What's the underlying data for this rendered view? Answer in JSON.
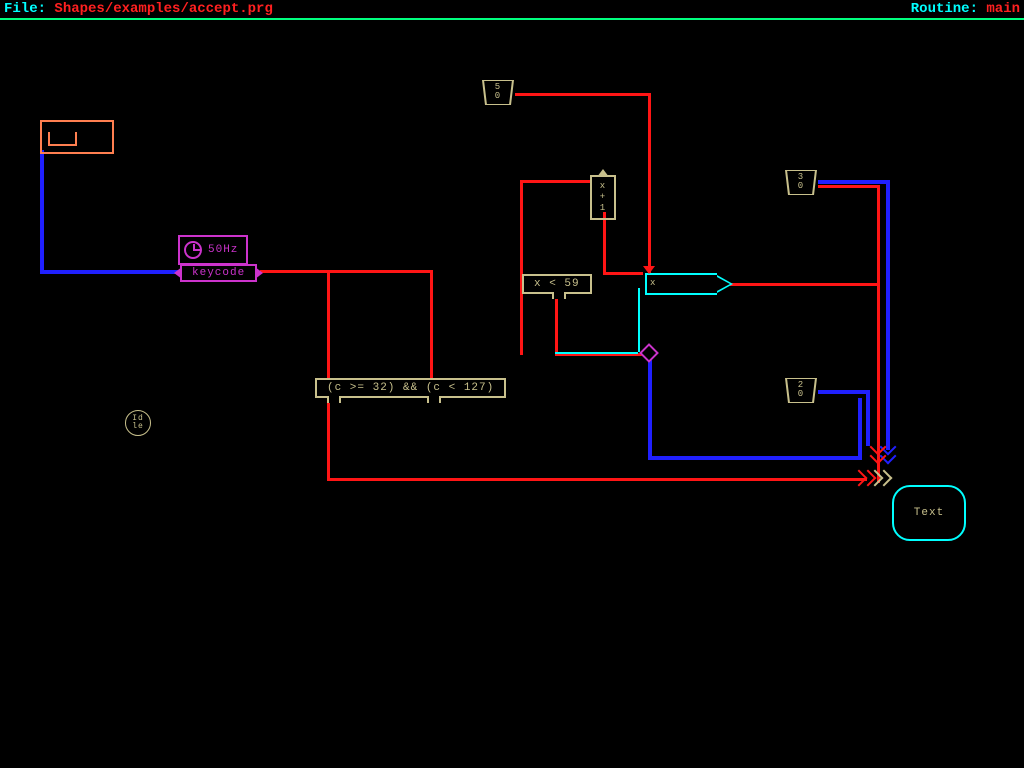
{
  "header": {
    "file_label": "File:",
    "file_value": "Shapes/examples/accept.prg",
    "routine_label": "Routine:",
    "routine_value": "main"
  },
  "timer": {
    "label": "50Hz"
  },
  "keycode": {
    "label": "keycode"
  },
  "cond_char": {
    "expr": "(c >= 32) && (c < 127)"
  },
  "cond_x": {
    "expr": "x < 59"
  },
  "incr": {
    "lines": [
      "x",
      "+",
      "1"
    ]
  },
  "mux": {
    "port": "x"
  },
  "const_50": {
    "lines": [
      "5",
      "0"
    ]
  },
  "const_30": {
    "lines": [
      "3",
      "0"
    ]
  },
  "const_20": {
    "lines": [
      "2",
      "0"
    ]
  },
  "idle": {
    "lines": [
      "Id",
      "le"
    ]
  },
  "sink": {
    "label": "Text"
  }
}
